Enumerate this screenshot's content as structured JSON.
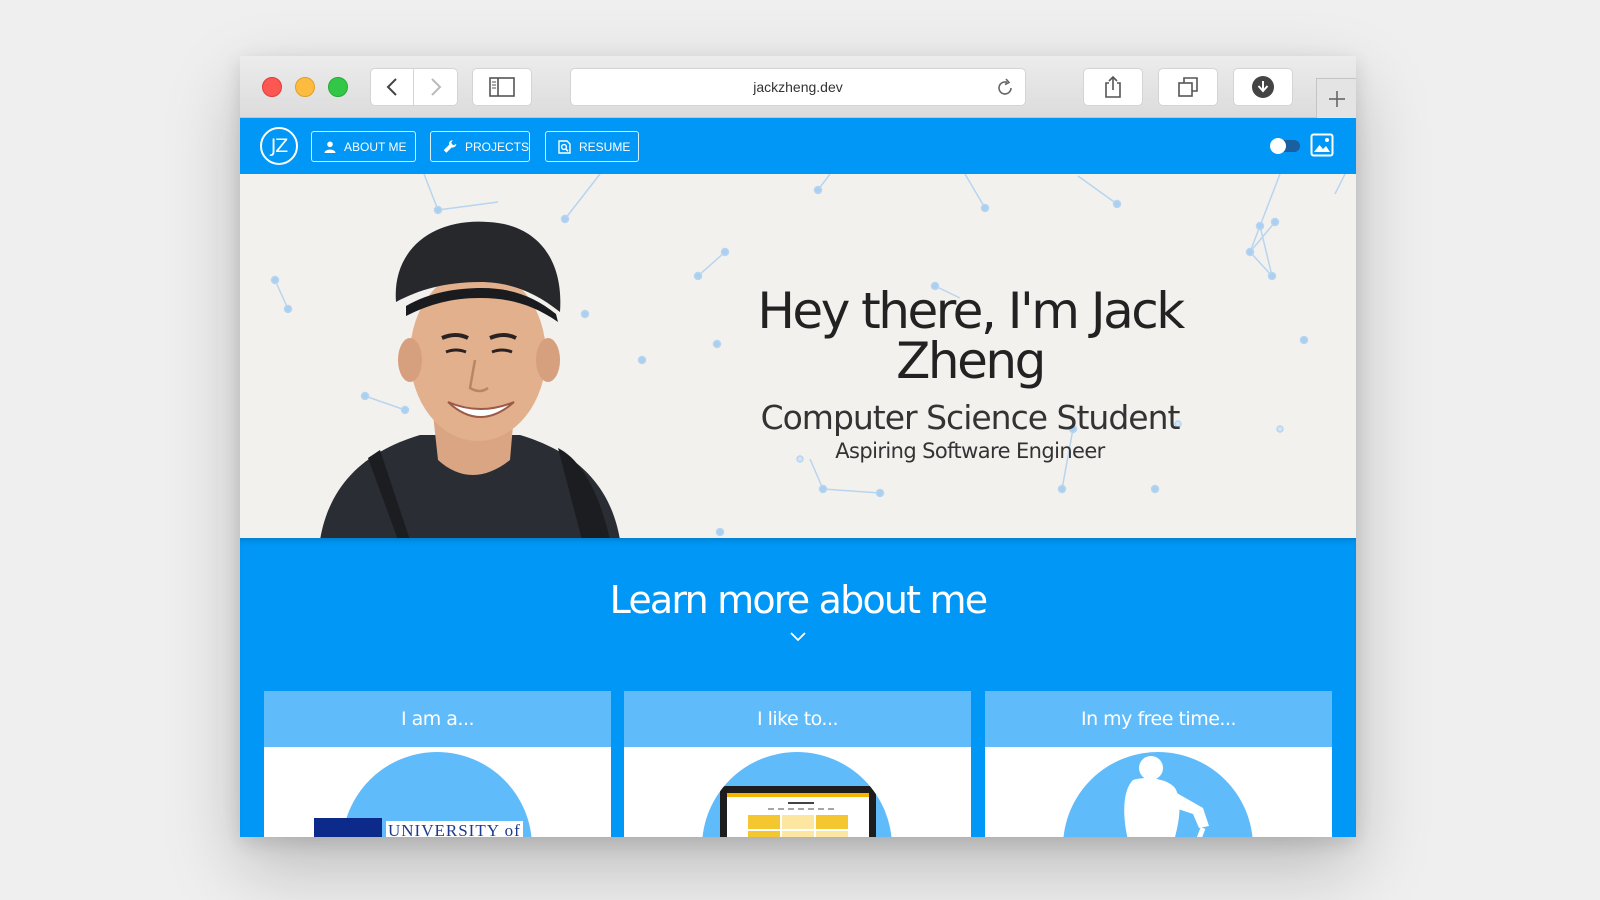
{
  "browser": {
    "url": "jackzheng.dev"
  },
  "nav": {
    "logo_text": "JZ",
    "buttons": [
      {
        "label": "ABOUT ME",
        "icon": "person-icon"
      },
      {
        "label": "PROJECTS",
        "icon": "wrench-icon"
      },
      {
        "label": "RESUME",
        "icon": "document-search-icon"
      }
    ]
  },
  "hero": {
    "title": "Hey there, I'm Jack Zheng",
    "subtitle": "Computer Science Student",
    "tagline": "Aspiring Software Engineer"
  },
  "about": {
    "title": "Learn more about me",
    "cards": [
      {
        "title": "I am a...",
        "badge_text": "UNIVERSITY of"
      },
      {
        "title": "I like to..."
      },
      {
        "title": "In my free time..."
      }
    ]
  },
  "colors": {
    "accent": "#0197f6",
    "card_header": "#60bbfb",
    "hero_bg": "#f3f1ee"
  }
}
